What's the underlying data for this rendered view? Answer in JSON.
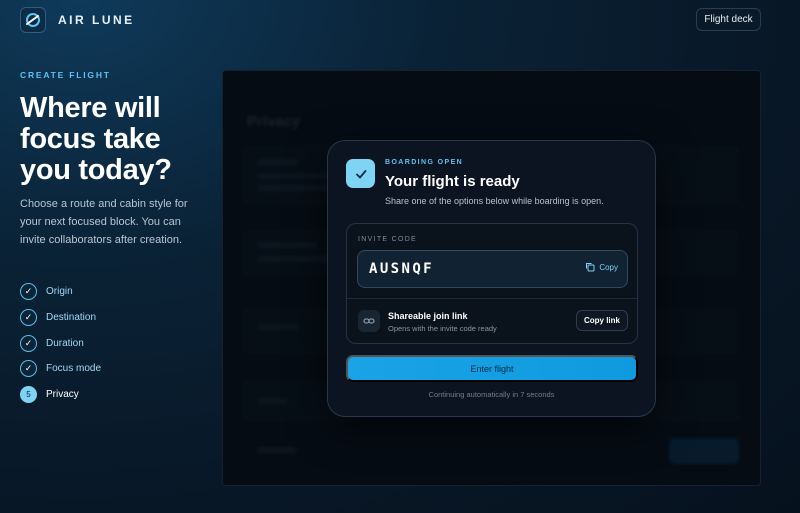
{
  "header": {
    "brand": "AIR LUNE",
    "flight_deck_label": "Flight deck"
  },
  "left": {
    "eyebrow": "CREATE FLIGHT",
    "hero": "Where will focus take you today?",
    "subtitle": "Choose a route and cabin style for your next focused block. You can invite collaborators after creation.",
    "steps": [
      {
        "label": "Origin",
        "status": "done",
        "marker": "✓"
      },
      {
        "label": "Destination",
        "status": "done",
        "marker": "✓"
      },
      {
        "label": "Duration",
        "status": "done",
        "marker": "✓"
      },
      {
        "label": "Focus mode",
        "status": "done",
        "marker": "✓"
      },
      {
        "label": "Privacy",
        "status": "current",
        "marker": "5"
      }
    ]
  },
  "background_form": {
    "title": "Privacy"
  },
  "modal": {
    "eyebrow": "BOARDING OPEN",
    "title": "Your flight is ready",
    "subtitle": "Share one of the options below while boarding is open.",
    "invite_label": "INVITE CODE",
    "invite_code": "AUSNQF",
    "copy_label": "Copy",
    "link_title": "Shareable join link",
    "link_subtitle": "Opens with the invite code ready",
    "copy_link_label": "Copy link",
    "enter_label": "Enter flight",
    "auto_note": "Continuing automatically in 7 seconds"
  },
  "colors": {
    "accent": "#5cc3f2",
    "primary_button": "#1aa3e6",
    "check_badge": "#7fd3f5"
  },
  "icons": [
    "logo-icon",
    "check-icon",
    "copy-icon",
    "link-icon"
  ]
}
